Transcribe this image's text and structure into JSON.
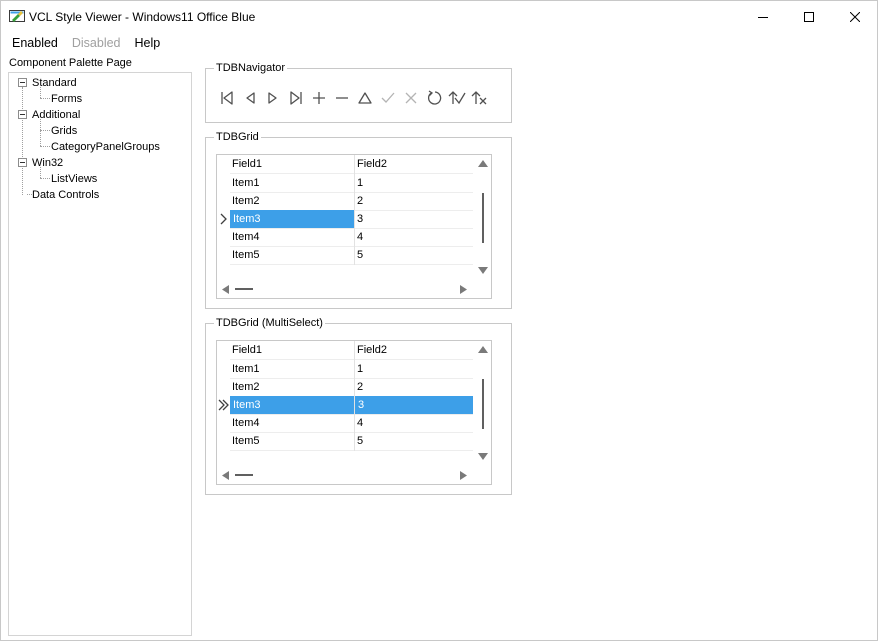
{
  "window": {
    "title": "VCL Style Viewer - Windows11 Office Blue"
  },
  "menu": [
    {
      "label": "Enabled",
      "enabled": true
    },
    {
      "label": "Disabled",
      "enabled": false
    },
    {
      "label": "Help",
      "enabled": true
    }
  ],
  "palette": {
    "label": "Component Palette Page",
    "tree": {
      "standard": "Standard",
      "forms": "Forms",
      "additional": "Additional",
      "grids": "Grids",
      "category_panel_groups": "CategoryPanelGroups",
      "win32": "Win32",
      "list_views": "ListViews",
      "data_controls": "Data Controls"
    }
  },
  "navigator": {
    "caption": "TDBNavigator",
    "buttons": [
      {
        "icon": "first-record-icon",
        "enabled": true
      },
      {
        "icon": "prior-record-icon",
        "enabled": true
      },
      {
        "icon": "next-record-icon",
        "enabled": true
      },
      {
        "icon": "last-record-icon",
        "enabled": true
      },
      {
        "icon": "insert-icon",
        "enabled": true
      },
      {
        "icon": "delete-icon",
        "enabled": true
      },
      {
        "icon": "edit-icon",
        "enabled": true
      },
      {
        "icon": "post-icon",
        "enabled": false
      },
      {
        "icon": "cancel-icon",
        "enabled": false
      },
      {
        "icon": "refresh-icon",
        "enabled": true
      },
      {
        "icon": "apply-updates-icon",
        "enabled": true
      },
      {
        "icon": "cancel-updates-icon",
        "enabled": true
      }
    ]
  },
  "grid1": {
    "caption": "TDBGrid",
    "columns": [
      "Field1",
      "Field2"
    ],
    "rows": [
      [
        "Item1",
        "1"
      ],
      [
        "Item2",
        "2"
      ],
      [
        "Item3",
        "3"
      ],
      [
        "Item4",
        "4"
      ],
      [
        "Item5",
        "5"
      ]
    ],
    "selected_row": 2
  },
  "grid2": {
    "caption": "TDBGrid (MultiSelect)",
    "columns": [
      "Field1",
      "Field2"
    ],
    "rows": [
      [
        "Item1",
        "1"
      ],
      [
        "Item2",
        "2"
      ],
      [
        "Item3",
        "3"
      ],
      [
        "Item4",
        "4"
      ],
      [
        "Item5",
        "5"
      ]
    ],
    "selected_row": 2
  },
  "colors": {
    "selection": "#3d9fe8",
    "border": "#c8c8c8",
    "icon": "#505050",
    "icon_disabled": "#b4b4b4"
  }
}
